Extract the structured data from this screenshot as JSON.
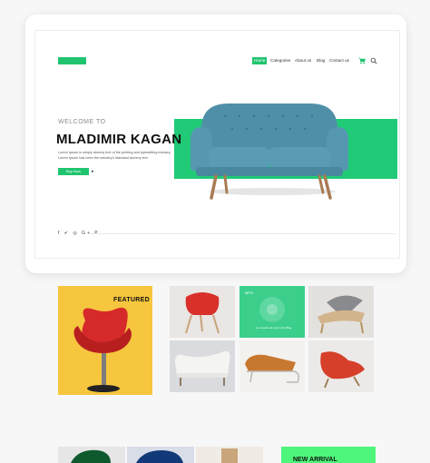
{
  "header": {
    "logo_text": "",
    "nav": [
      "Home",
      "Categories",
      "About us",
      "Blog",
      "Contact us"
    ]
  },
  "hero": {
    "welcome": "WELCOME TO",
    "name": "MLADIMIR KAGAN",
    "description": "Lorem Ipsum is simply dummy text of the printing and typesetting industry. Lorem Ipsum has been the industry's standard dummy text",
    "button_label": "Buy Now",
    "arrow": "▸",
    "social": "f  ✔  ◎  G+  P"
  },
  "gallery": {
    "featured_label": "FEATURED",
    "green_tile_label": "NETS",
    "green_tile_caption": "Le mesure du Lorem de Miag"
  },
  "bottom": {
    "new_arrival_label": "NEW ARRIVAL"
  },
  "colors": {
    "accent": "#20c46f",
    "hero_band": "#21ca76",
    "featured_bg": "#f6c63e",
    "sofa": "#4f8fa8",
    "new_arrival_bg": "#4df57a"
  }
}
